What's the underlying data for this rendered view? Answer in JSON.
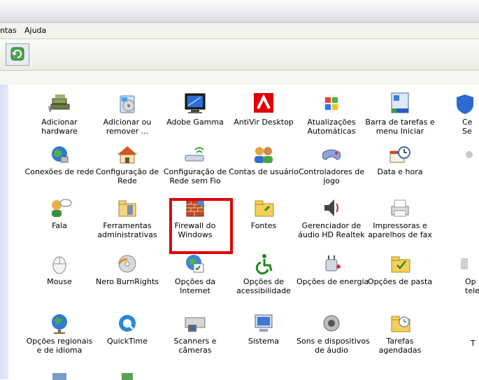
{
  "menu": {
    "item_tools_partial": "ntas",
    "item_help": "Ajuda"
  },
  "items": [
    {
      "label": "Adicionar hardware",
      "icon": "hardware-icon"
    },
    {
      "label": "Adicionar ou remover ...",
      "icon": "add-remove-programs-icon"
    },
    {
      "label": "Adobe Gamma",
      "icon": "adobe-gamma-icon"
    },
    {
      "label": "AntiVir Desktop",
      "icon": "antivir-icon"
    },
    {
      "label": "Atualizações Automáticas",
      "icon": "windows-update-icon"
    },
    {
      "label": "Barra de tarefas e menu Iniciar",
      "icon": "taskbar-icon"
    },
    {
      "label": "Ce Se",
      "icon": "security-center-icon"
    },
    {
      "label": "Conexões de rede",
      "icon": "network-connections-icon"
    },
    {
      "label": "Configuração de Rede",
      "icon": "network-setup-icon"
    },
    {
      "label": "Configuração de Rede sem Fio",
      "icon": "wireless-setup-icon"
    },
    {
      "label": "Contas de usuário",
      "icon": "user-accounts-icon"
    },
    {
      "label": "Controladores de jogo",
      "icon": "game-controller-icon"
    },
    {
      "label": "Data e hora",
      "icon": "date-time-icon"
    },
    {
      "label": "Fala",
      "icon": "speech-icon"
    },
    {
      "label": "Ferramentas administrativas",
      "icon": "admin-tools-icon"
    },
    {
      "label": "Firewall do Windows",
      "icon": "firewall-icon"
    },
    {
      "label": "Fontes",
      "icon": "fonts-folder-icon"
    },
    {
      "label": "Gerenciador de áudio HD Realtek",
      "icon": "realtek-audio-icon"
    },
    {
      "label": "Impressoras e aparelhos de fax",
      "icon": "printers-icon"
    },
    {
      "label": "Mouse",
      "icon": "mouse-icon"
    },
    {
      "label": "Nero BurnRights",
      "icon": "nero-icon"
    },
    {
      "label": "Opções da Internet",
      "icon": "internet-options-icon"
    },
    {
      "label": "Opções de acessibilidade",
      "icon": "accessibility-icon"
    },
    {
      "label": "Opções de energia",
      "icon": "power-options-icon"
    },
    {
      "label": "Opções de pasta",
      "icon": "folder-options-icon"
    },
    {
      "label": "Op telefo",
      "icon": "phone-modem-icon"
    },
    {
      "label": "Opções regionais e de idioma",
      "icon": "regional-options-icon"
    },
    {
      "label": "QuickTime",
      "icon": "quicktime-icon"
    },
    {
      "label": "Scanners e câmeras",
      "icon": "scanner-icon"
    },
    {
      "label": "Sistema",
      "icon": "system-icon"
    },
    {
      "label": "Sons e dispositivos de áudio",
      "icon": "sounds-icon"
    },
    {
      "label": "Tarefas agendadas",
      "icon": "scheduled-tasks-icon"
    },
    {
      "label": "T",
      "icon": "taskbar-partial-icon"
    }
  ]
}
